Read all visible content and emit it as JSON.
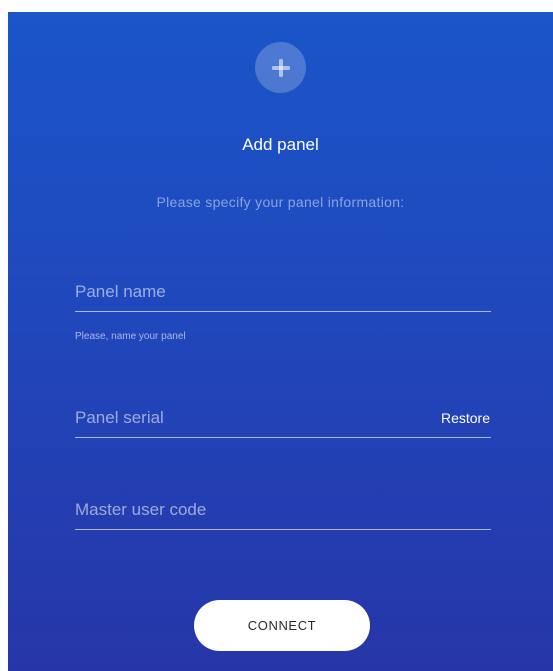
{
  "header": {
    "add_icon": "plus-icon",
    "title": "Add panel",
    "subtitle": "Please specify your panel information:"
  },
  "form": {
    "panel_name": {
      "placeholder": "Panel name",
      "value": "",
      "helper": "Please, name your panel"
    },
    "panel_serial": {
      "placeholder": "Panel serial",
      "value": "",
      "restore_label": "Restore"
    },
    "master_user_code": {
      "placeholder": "Master user code",
      "value": ""
    }
  },
  "actions": {
    "connect_label": "CONNECT"
  },
  "colors": {
    "gradient_top": "#1a55c9",
    "gradient_bottom": "#2636a8",
    "button_bg": "#ffffff",
    "text": "#ffffff"
  }
}
